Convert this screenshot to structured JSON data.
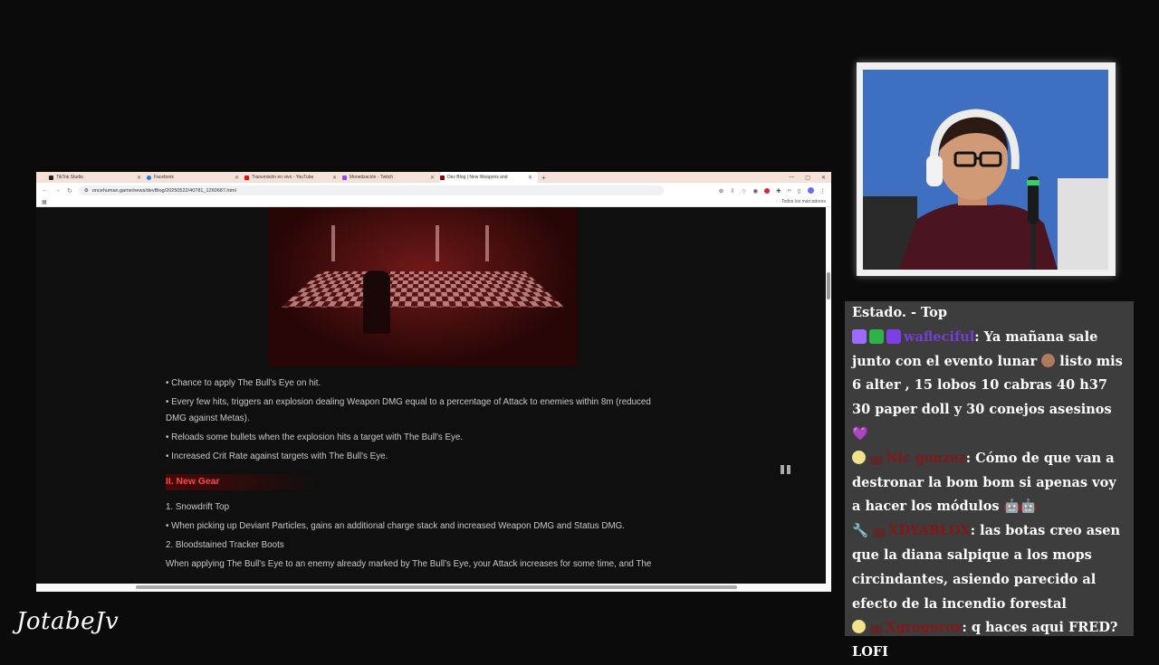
{
  "browser": {
    "tabs": [
      {
        "label": "TikTok Studio",
        "color": "#222222"
      },
      {
        "label": "Facebook",
        "color": "#1877f2"
      },
      {
        "label": "Transmisión en vivo - YouTube",
        "color": "#ff0000"
      },
      {
        "label": "Monetización - Twitch",
        "color": "#9146ff"
      },
      {
        "label": "Dev Blog | New Weapons and",
        "color": "#8b0000"
      }
    ],
    "new_tab": "+",
    "url": "oncehuman.game/news/devBlog/20250522/40781_1260687.html",
    "bookmarks_folder": "Todos los marcadores"
  },
  "article": {
    "bullets": [
      "• Chance to apply The Bull's Eye on hit.",
      "• Every few hits, triggers an explosion dealing Weapon DMG equal to a percentage of Attack to enemies within 8m (reduced DMG against Metas).",
      "• Reloads some bullets when the explosion hits a target with The Bull's Eye.",
      "• Increased Crit Rate against targets with The Bull's Eye."
    ],
    "section_title": "II. New Gear",
    "items": [
      "1. Snowdrift Top",
      "• When picking up Deviant Particles, gains an additional charge stack and increased Weapon DMG and Status DMG.",
      "2. Bloodstained Tracker Boots",
      "When applying The Bull's Eye to an enemy already marked by The Bull's Eye, your Attack increases for some time, and The"
    ]
  },
  "chat": {
    "header": "Estado. - Top",
    "messages": [
      {
        "user": "wafleciful",
        "user_color": "#7b3fe4",
        "text": ": Ya mañana sale junto con el evento lunar",
        "text2": " listo mis 6 alter , 15 lobos 10 cabras 40 h37 30 paper doll y 30 conejos asesinos"
      },
      {
        "user": "Nic gonzez",
        "user_color": "#8a1515",
        "text": ": Cómo de que van a destronar la bom bom si apenas voy a hacer los módulos"
      },
      {
        "user": "XDYABLOX",
        "user_color": "#8a1515",
        "text": ": las botas creo asen que la diana salpique a los mops circindantes, asiendo parecido al efecto de la incendio forestal"
      },
      {
        "user": "Xgrogorox",
        "user_color": "#8a1515",
        "text": ": q haces aqui FRED? LOFI"
      }
    ]
  },
  "channel": "JotabeJv"
}
